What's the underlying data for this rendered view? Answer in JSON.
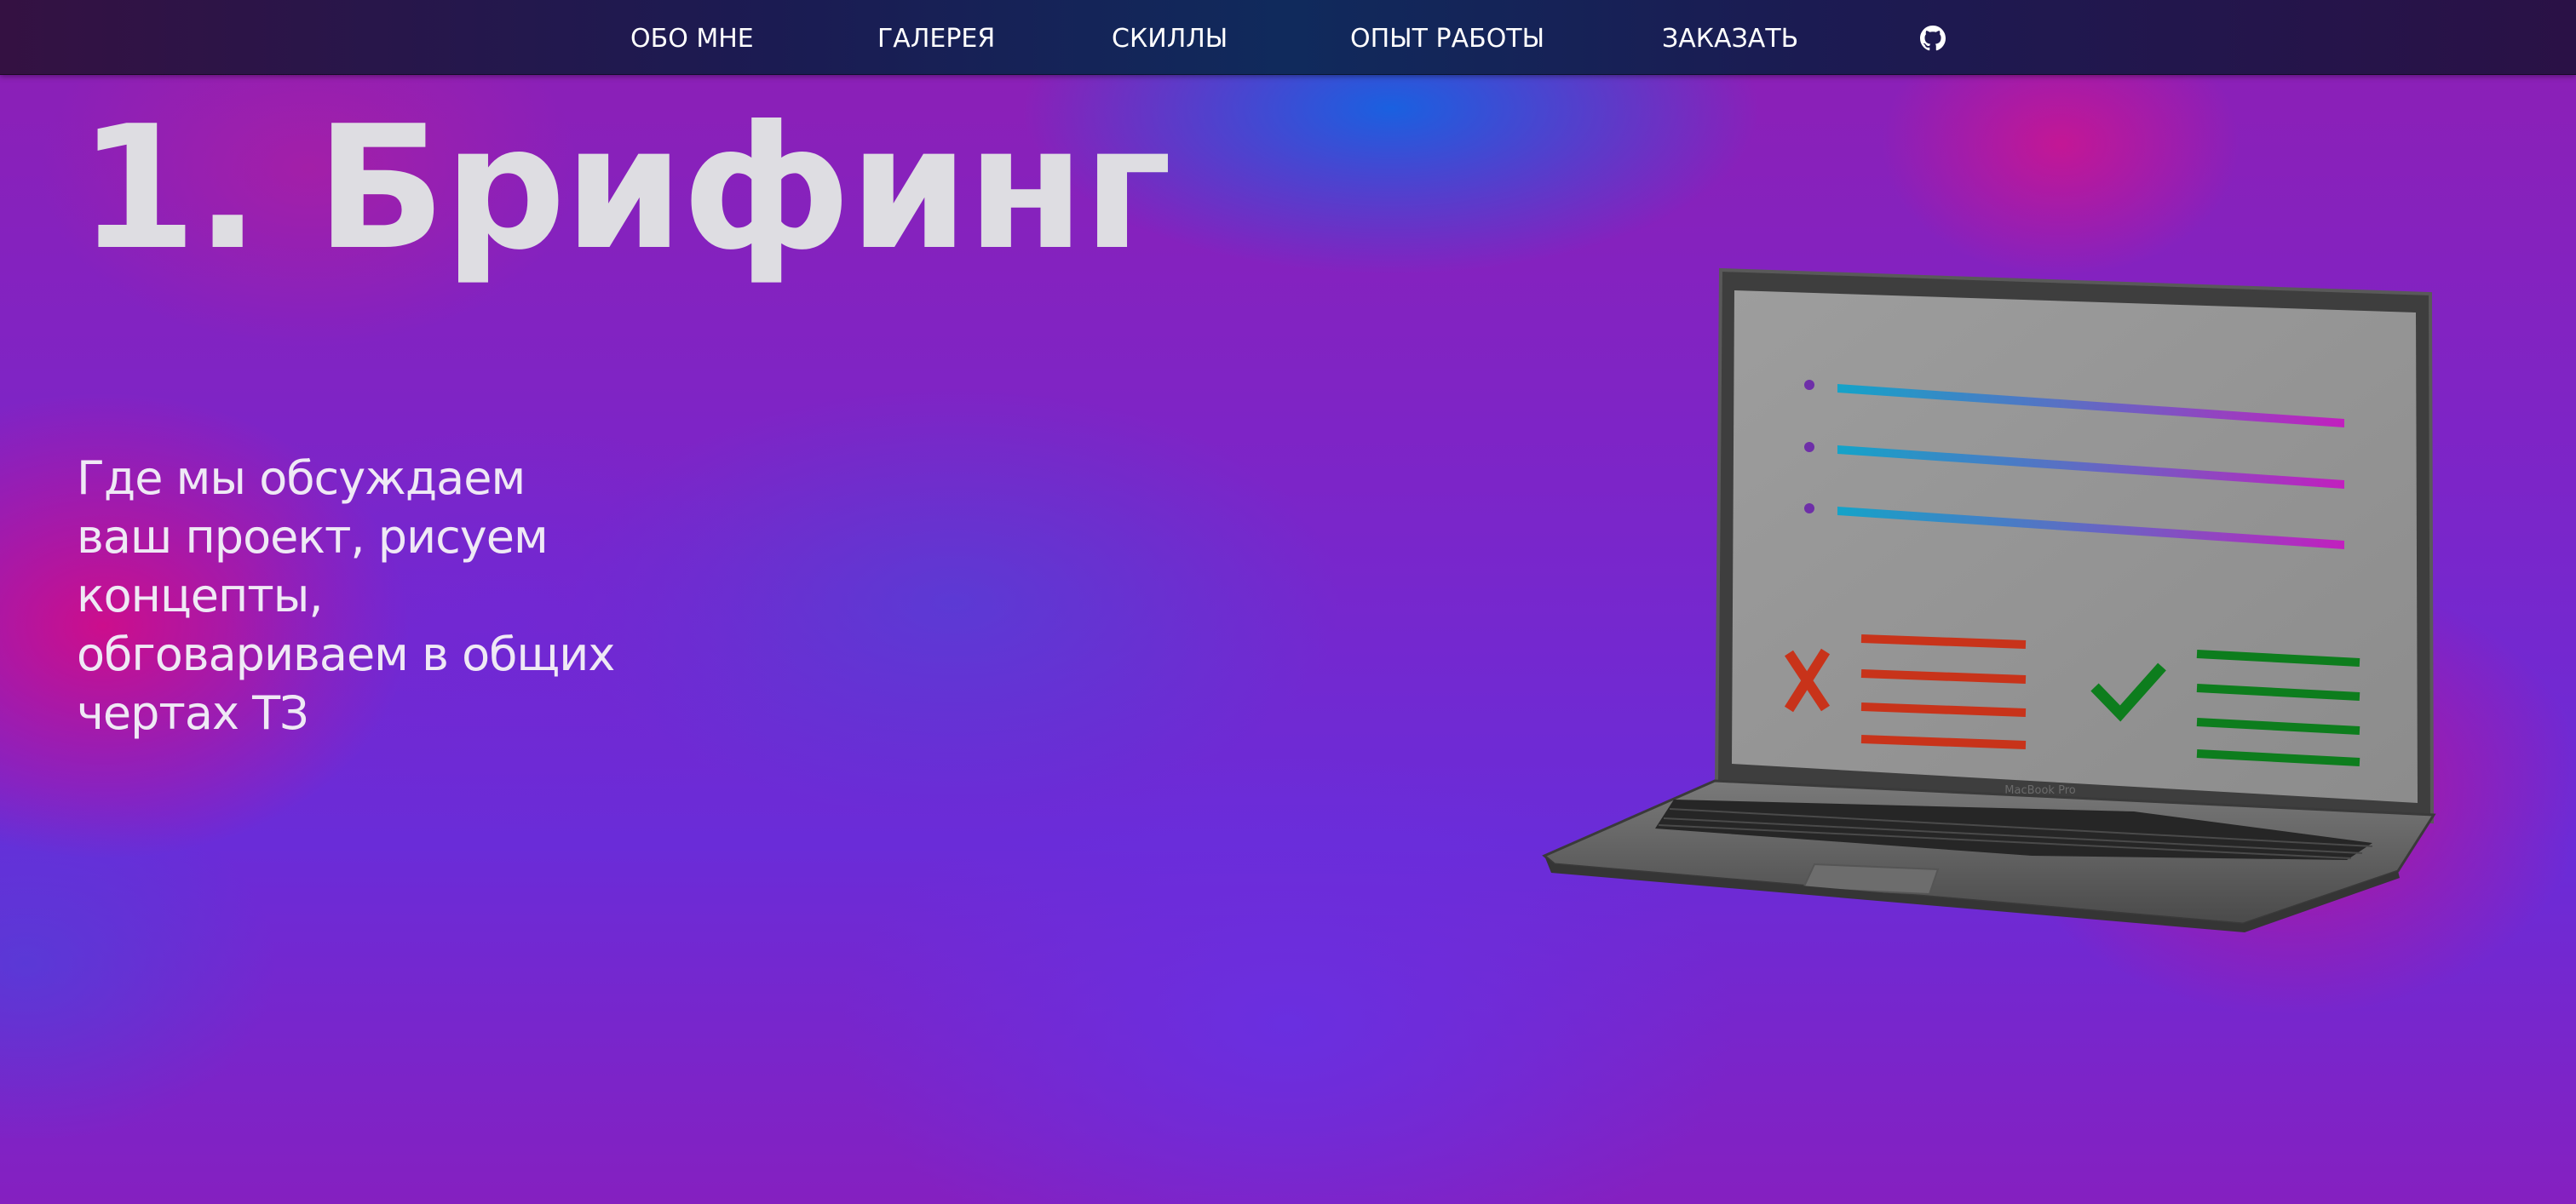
{
  "nav": {
    "items": [
      {
        "id": "about",
        "label": "ОБО МНЕ"
      },
      {
        "id": "gallery",
        "label": "ГАЛЕРЕЯ"
      },
      {
        "id": "skills",
        "label": "СКИЛЛЫ"
      },
      {
        "id": "work",
        "label": "ОПЫТ РАБОТЫ"
      },
      {
        "id": "order",
        "label": "ЗАКАЗАТЬ"
      }
    ],
    "github_icon": "github-icon"
  },
  "hero": {
    "title": "1. Брифинг",
    "description": "Где мы обсуждаем ваш проект, рисуем концепты, обговариваем в общих чертах ТЗ"
  },
  "illustration": {
    "laptop_label": "MacBook Pro",
    "icons": [
      "cross-icon",
      "check-icon"
    ]
  },
  "colors": {
    "cross": "#c8331a",
    "check": "#0d7d1d",
    "accent_cyan": "#14a3c8",
    "accent_magenta": "#c21fbe"
  }
}
